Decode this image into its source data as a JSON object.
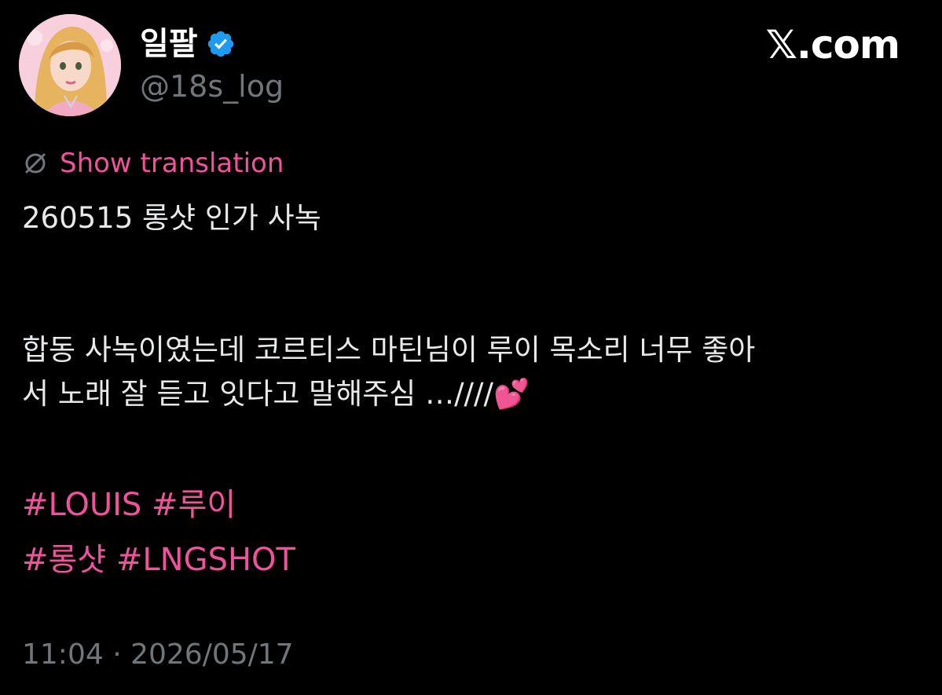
{
  "author": {
    "display_name": "일팔",
    "handle": "@18s_log",
    "verified": true
  },
  "brand": "𝕏.com",
  "translate_label": "Show translation",
  "tweet": {
    "line1": "260515 롱샷 인가 사녹",
    "line2": "합동 사녹이였는데 코르티스 마틴님이 루이 목소리 너무 좋아",
    "line3": "서 노래 잘 듣고 잇다고 말해주심 …////💕"
  },
  "hashtags": {
    "row1": [
      "#LOUIS",
      "#루이"
    ],
    "row2": [
      "#롱샷",
      "#LNGSHOT"
    ]
  },
  "timestamp": "11:04 · 2026/05/17",
  "colors": {
    "background": "#000000",
    "accent": "#f0529c",
    "muted": "#71767b",
    "verified": "#1d9bf0"
  },
  "icons": {
    "verified": "verified-badge-icon",
    "translate": "translate-globe-icon"
  }
}
